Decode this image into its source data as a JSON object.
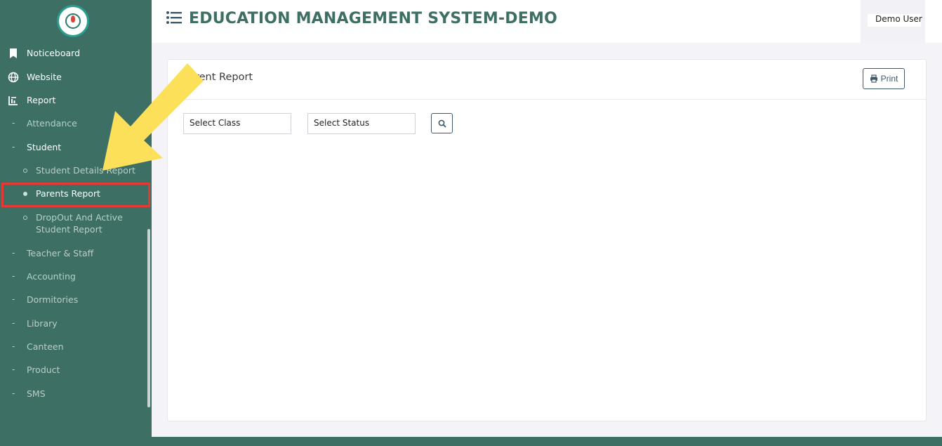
{
  "header": {
    "app_title": "EDUCATION MANAGEMENT SYSTEM-DEMO",
    "user_name": "Demo User"
  },
  "sidebar": {
    "items": [
      {
        "label": "Noticeboard",
        "icon": "bookmark-icon"
      },
      {
        "label": "Website",
        "icon": "globe-icon"
      },
      {
        "label": "Report",
        "icon": "chart-icon"
      }
    ],
    "report_children": [
      {
        "label": "Attendance"
      },
      {
        "label": "Student"
      }
    ],
    "student_children": [
      {
        "label": "Student Details Report"
      },
      {
        "label": "Parents Report"
      },
      {
        "label": "DropOut And Active",
        "label2": "Student Report"
      }
    ],
    "more_children": [
      {
        "label": "Teacher & Staff"
      },
      {
        "label": "Accounting"
      },
      {
        "label": "Dormitories"
      },
      {
        "label": "Library"
      },
      {
        "label": "Canteen"
      },
      {
        "label": "Product"
      },
      {
        "label": "SMS"
      }
    ]
  },
  "main": {
    "card_title": "Parent Report",
    "print_label": "Print",
    "select_class": "Select Class",
    "select_status": "Select Status"
  },
  "colors": {
    "sidebar": "#3d6f64",
    "highlight": "#e53935",
    "arrow": "#fde05a"
  }
}
